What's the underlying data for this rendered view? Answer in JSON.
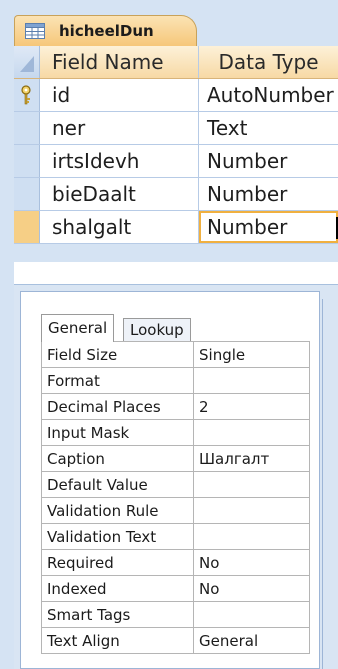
{
  "tab": {
    "title": "hicheelDun",
    "icon": "table-icon"
  },
  "grid": {
    "headers": {
      "field_name": "Field Name",
      "data_type": "Data Type"
    },
    "rows": [
      {
        "field": "id",
        "type": "AutoNumber",
        "primary_key": true
      },
      {
        "field": "ner",
        "type": "Text"
      },
      {
        "field": "irtsIdevh",
        "type": "Number"
      },
      {
        "field": "bieDaalt",
        "type": "Number"
      },
      {
        "field": "shalgalt",
        "type": "Number",
        "selected": true
      }
    ]
  },
  "properties": {
    "tabs": {
      "general": "General",
      "lookup": "Lookup"
    },
    "rows": [
      {
        "name": "Field Size",
        "value": "Single"
      },
      {
        "name": "Format",
        "value": ""
      },
      {
        "name": "Decimal Places",
        "value": "2"
      },
      {
        "name": "Input Mask",
        "value": ""
      },
      {
        "name": "Caption",
        "value": "Шалгалт"
      },
      {
        "name": "Default Value",
        "value": ""
      },
      {
        "name": "Validation Rule",
        "value": ""
      },
      {
        "name": "Validation Text",
        "value": ""
      },
      {
        "name": "Required",
        "value": "No"
      },
      {
        "name": "Indexed",
        "value": "No"
      },
      {
        "name": "Smart Tags",
        "value": ""
      },
      {
        "name": "Text Align",
        "value": "General"
      }
    ]
  },
  "colors": {
    "accent": "#f6c77a",
    "grid_line": "#b7cbe6",
    "background": "#d5e3f3"
  }
}
